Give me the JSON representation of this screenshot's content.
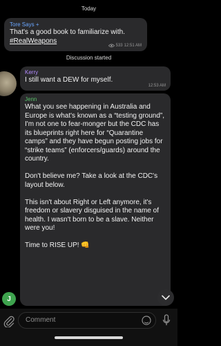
{
  "day_divider": "Today",
  "messages": [
    {
      "sender": "Tore Says",
      "sender_badge": "+",
      "text": "That's a good book to familiarize with.",
      "hashtag": "#RealWeapons",
      "views": "533",
      "time": "12:51 AM"
    },
    {
      "system": "Discussion started"
    },
    {
      "sender": "Kerry",
      "text": "I still want a DEW for myself.",
      "time": "12:53 AM"
    },
    {
      "sender": "Jenn",
      "text": "What you see happening in Australia and Europe is what's known as a “testing ground”, I'm not one to fear-monger but the CDC has its blueprints right here for “Quarantine camps” and they have begun posting jobs for “strike teams” (enforcers/guards) around the country.\n\nDon't believe me? Take a look at the CDC's layout below.\n\nThis isn't about Right or Left anymore, it's freedom or slavery disguised in the name of health. I wasn't born to be a slave. Neither were you!\n\nTime to RISE UP! 👊",
      "avatar_letter": "J"
    }
  ],
  "input": {
    "placeholder": "Comment"
  },
  "colors": {
    "background": "#000000",
    "bubble": "#2a2a2c",
    "tore_name": "#6ba7ff",
    "kerry_name": "#b48cff",
    "jenn_name": "#58c26a",
    "jenn_avatar": "#3ea34e"
  },
  "icons": [
    "eye-icon",
    "attach-icon",
    "sticker-icon",
    "mic-icon",
    "chevron-down-icon"
  ]
}
